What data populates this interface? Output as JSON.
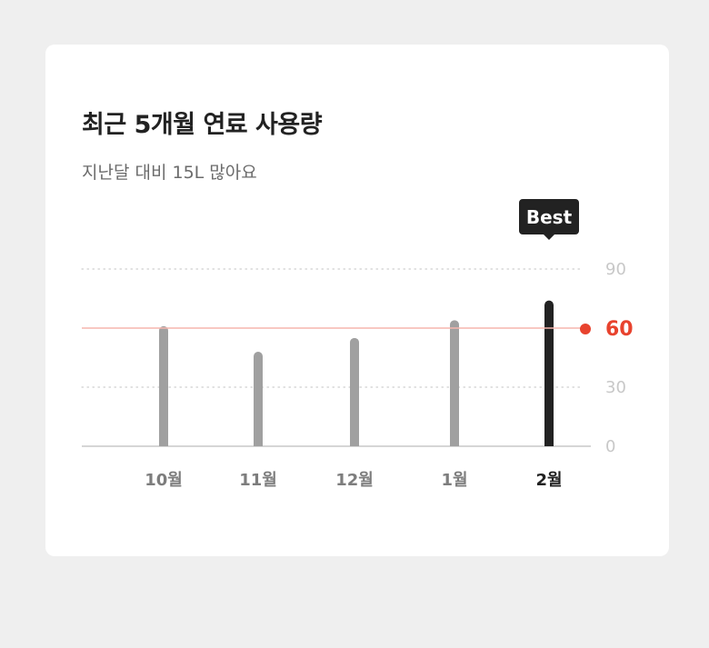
{
  "card": {
    "title": "최근 5개월 연료 사용량",
    "subtitle": "지난달 대비 15L 많아요"
  },
  "chart_data": {
    "type": "bar",
    "categories": [
      "10월",
      "11월",
      "12월",
      "1월",
      "2월"
    ],
    "values": [
      61,
      48,
      55,
      64,
      74
    ],
    "ylim": [
      0,
      90
    ],
    "yticks": [
      0,
      30,
      60,
      90
    ],
    "reference_line": {
      "value": 60,
      "label": "60",
      "color": "#e8432e"
    },
    "highlight_index": 4,
    "highlight_badge": "Best",
    "grid": true,
    "colors": {
      "bar": "#a0a0a0",
      "bar_highlight": "#222222",
      "tick_label": "#c8c8c8",
      "category_label": "#7d7d7d",
      "category_label_highlight": "#222222",
      "reference_line": "#f5b5ad",
      "grid": "#cfcfcf",
      "baseline": "#d6d6d6"
    }
  }
}
